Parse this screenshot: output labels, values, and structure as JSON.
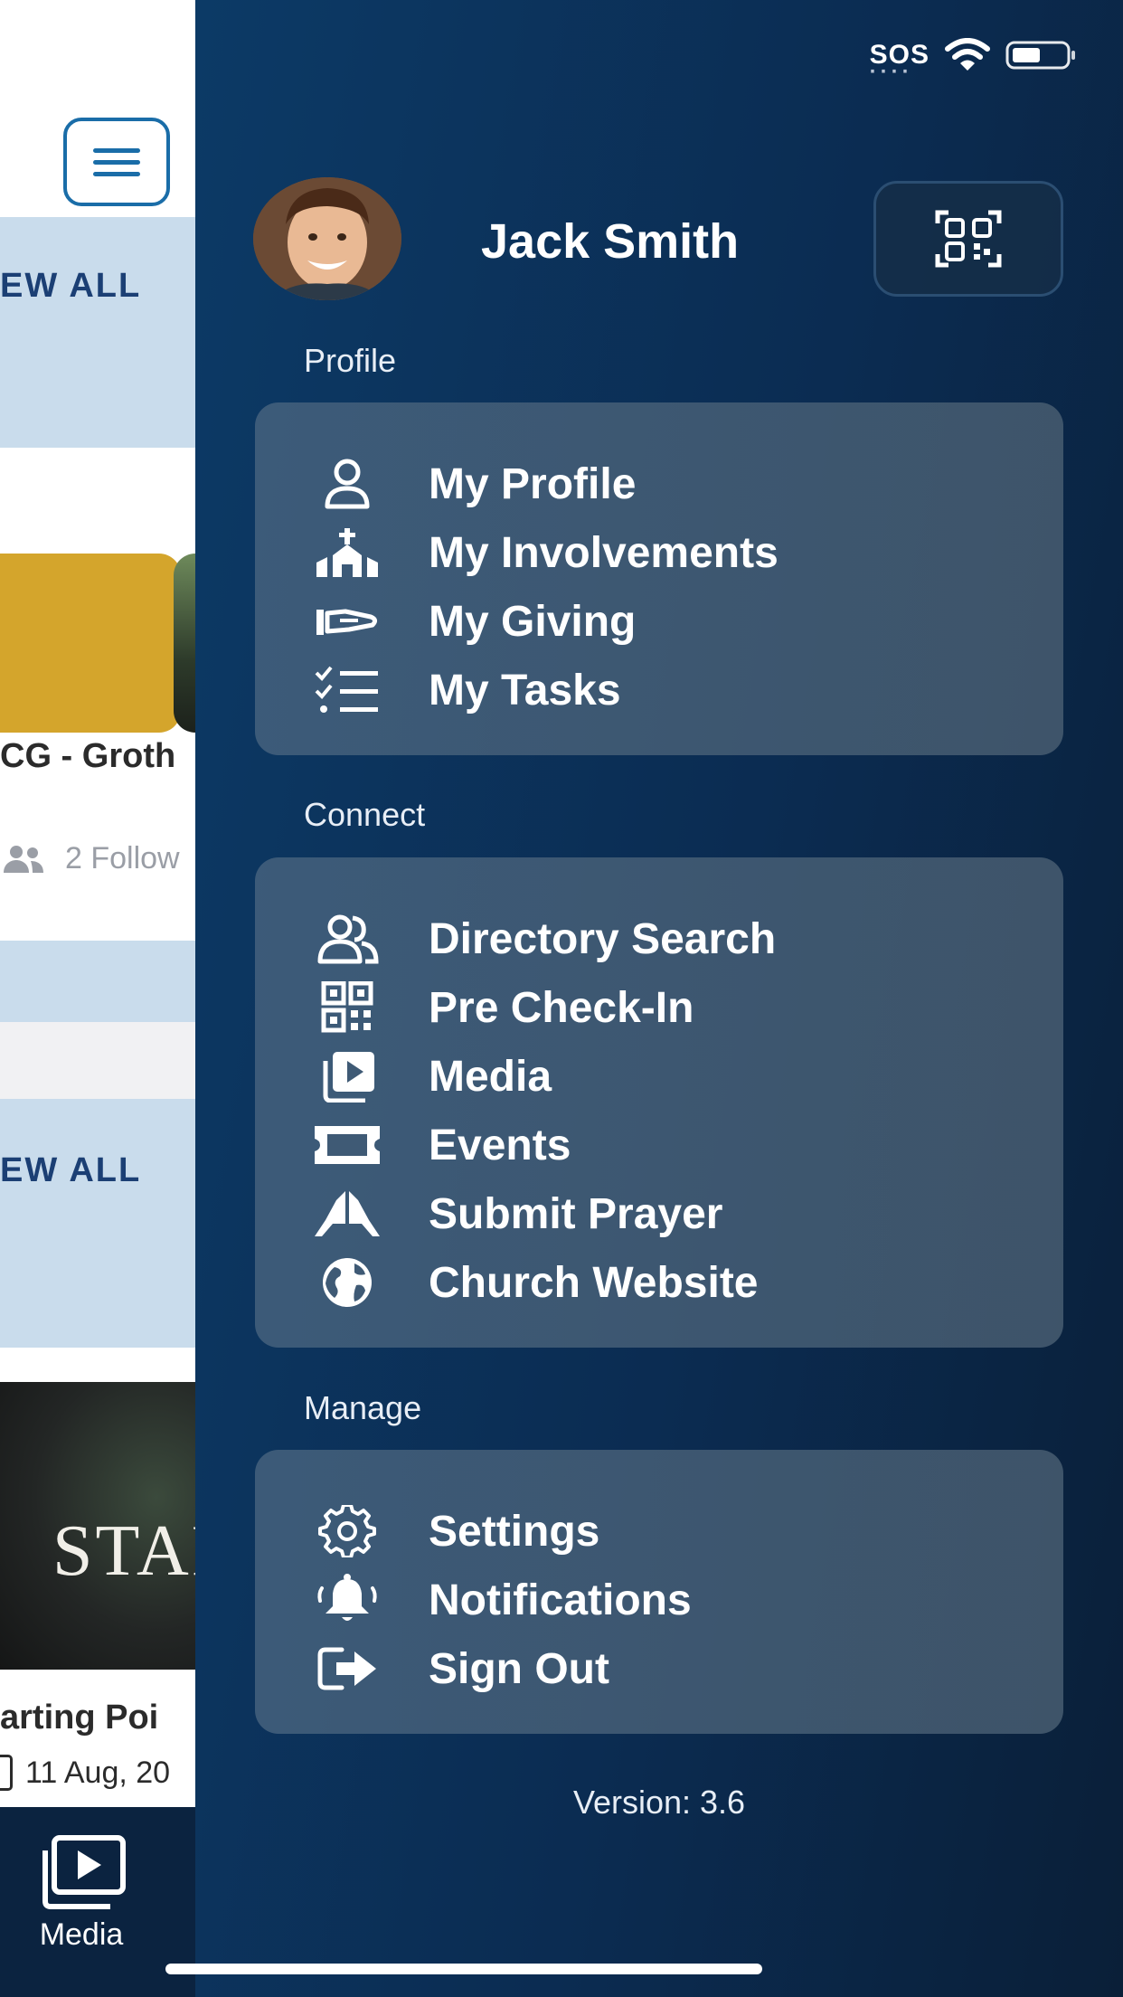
{
  "background_app": {
    "view_all_label": "EW ALL",
    "group_card": {
      "name": "CG - Groth",
      "followers": "2 Follow"
    },
    "media_card": {
      "thumbnail_text": "STAR",
      "title": "arting Poi",
      "date": "11 Aug, 20"
    },
    "bottom_tab": {
      "label": "Media",
      "icon": "media-play-icon"
    }
  },
  "status_bar": {
    "sos": "SOS",
    "wifi": "wifi-icon",
    "battery": "battery-icon"
  },
  "drawer": {
    "user_name": "Jack Smith",
    "avatar": "profile-photo",
    "qr_button_icon": "qr-scan-icon",
    "sections": {
      "profile": {
        "label": "Profile",
        "items": [
          {
            "label": "My Profile",
            "icon": "person-icon"
          },
          {
            "label": "My Involvements",
            "icon": "church-icon"
          },
          {
            "label": "My Giving",
            "icon": "giving-hand-icon"
          },
          {
            "label": "My Tasks",
            "icon": "checklist-icon"
          }
        ]
      },
      "connect": {
        "label": "Connect",
        "items": [
          {
            "label": "Directory Search",
            "icon": "people-icon"
          },
          {
            "label": "Pre Check-In",
            "icon": "qr-code-icon"
          },
          {
            "label": "Media",
            "icon": "media-play-icon"
          },
          {
            "label": "Events",
            "icon": "ticket-icon"
          },
          {
            "label": "Submit Prayer",
            "icon": "praying-hands-icon"
          },
          {
            "label": "Church Website",
            "icon": "globe-icon"
          }
        ]
      },
      "manage": {
        "label": "Manage",
        "items": [
          {
            "label": "Settings",
            "icon": "gear-icon"
          },
          {
            "label": "Notifications",
            "icon": "bell-icon"
          },
          {
            "label": "Sign Out",
            "icon": "sign-out-icon"
          }
        ]
      }
    },
    "version": "Version: 3.6"
  },
  "colors": {
    "drawer_background": "#0b2c52",
    "card_background": "#4a6580",
    "accent_blue": "#1a6da8",
    "text_white": "#ffffff",
    "band_light_blue": "#c9dcec"
  }
}
